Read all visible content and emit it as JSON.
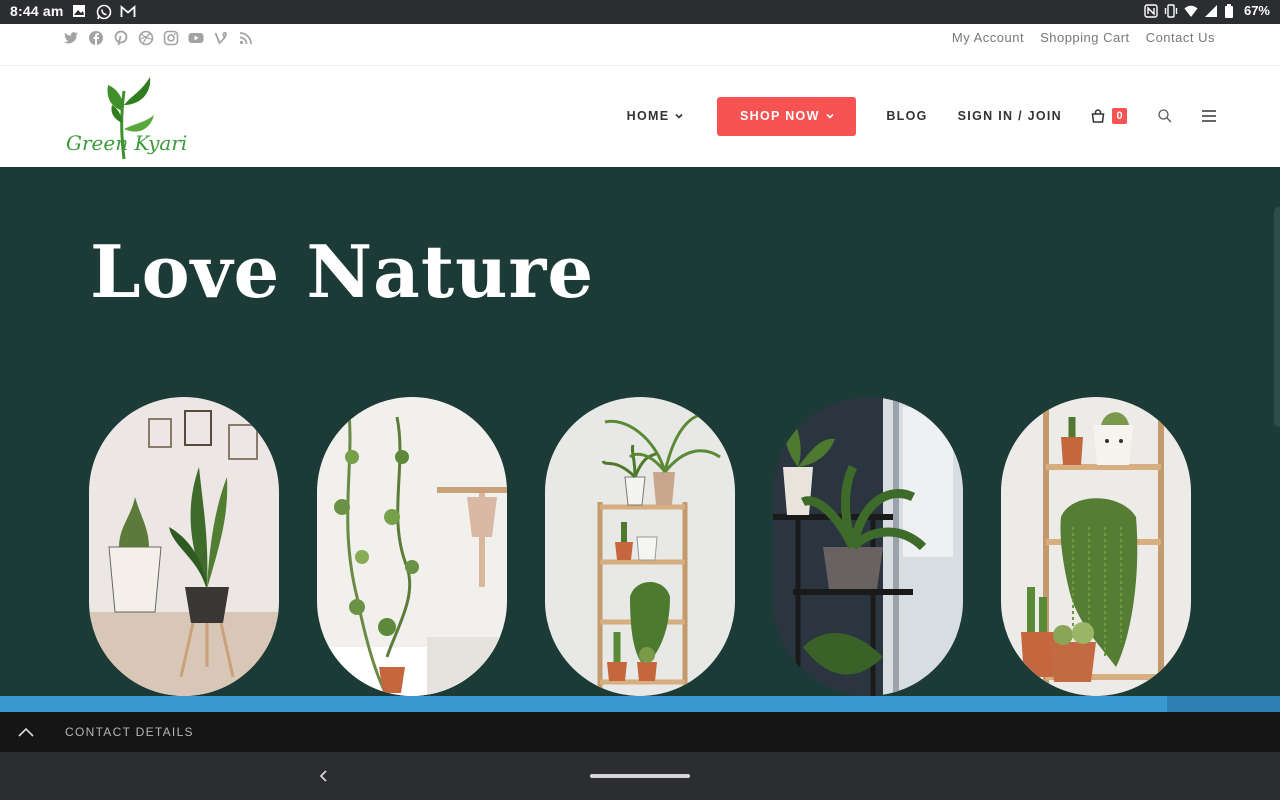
{
  "status_bar": {
    "time": "8:44 am",
    "battery": "67%",
    "left_icons": [
      "image-icon",
      "whatsapp-icon",
      "gmail-icon"
    ],
    "right_icons": [
      "nfc-icon",
      "vibrate-icon",
      "wifi-icon",
      "signal-icon",
      "battery-icon"
    ]
  },
  "top_bar": {
    "social_icons": [
      "twitter-icon",
      "facebook-icon",
      "pinterest-icon",
      "dribbble-icon",
      "instagram-icon",
      "youtube-icon",
      "vine-icon",
      "rss-icon"
    ],
    "links": [
      "My Account",
      "Shopping Cart",
      "Contact Us"
    ]
  },
  "header": {
    "logo_text": "Green Kyari",
    "nav": {
      "home": "HOME",
      "shop_now": "SHOP NOW",
      "blog": "BLOG",
      "sign_in": "SIGN IN / JOIN"
    },
    "cart_count": "0"
  },
  "hero": {
    "title": "Love Nature",
    "images": [
      "plant-photo-1",
      "plant-photo-2",
      "plant-photo-3",
      "plant-photo-4",
      "plant-photo-5"
    ]
  },
  "footer": {
    "contact_label": "CONTACT DETAILS"
  },
  "colors": {
    "accent": "#f75353",
    "hero_bg": "#1c3b37",
    "strip": "#3899d1",
    "footer_bg": "#151515"
  }
}
